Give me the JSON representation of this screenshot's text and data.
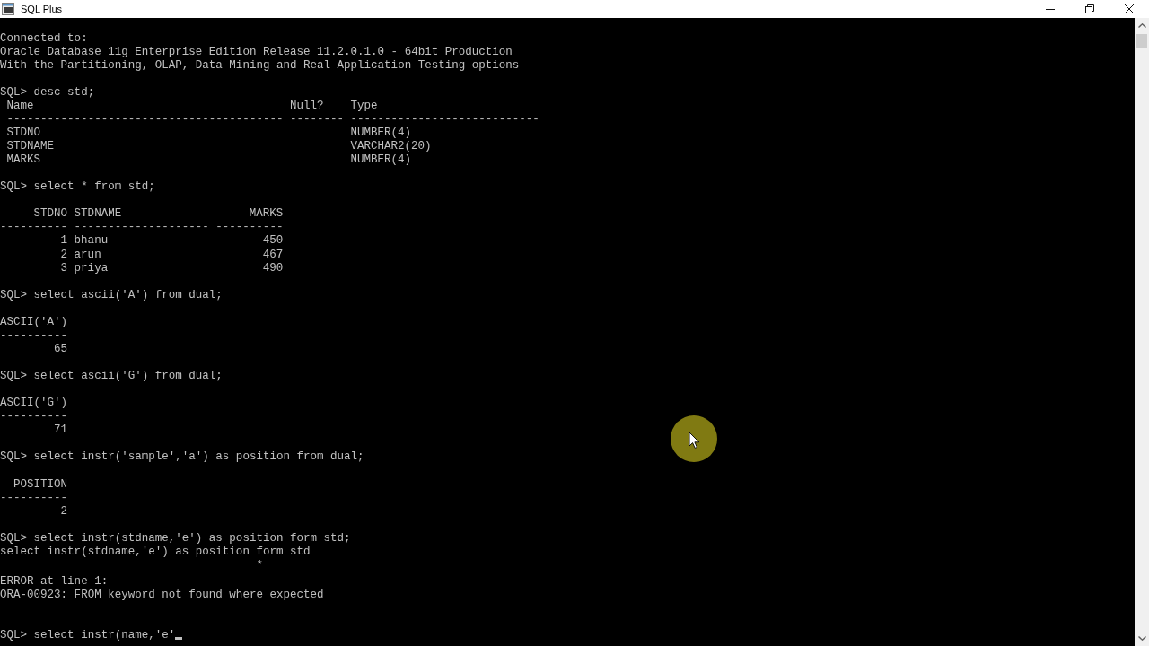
{
  "window": {
    "title": "SQL Plus"
  },
  "console": {
    "blocks": [
      {
        "kind": "text",
        "lines": [
          "Connected to:",
          "Oracle Database 11g Enterprise Edition Release 11.2.0.1.0 - 64bit Production",
          "With the Partitioning, OLAP, Data Mining and Real Application Testing options"
        ]
      },
      {
        "kind": "text",
        "lines": [
          "SQL> desc std;"
        ]
      },
      {
        "kind": "describe",
        "columns": [
          {
            "heading": "Name",
            "rule": "-----------------------------------------",
            "kind": "text"
          },
          {
            "heading": "Null?",
            "rule": "--------",
            "kind": "text"
          },
          {
            "heading": "Type",
            "rule": "----------------------------",
            "kind": "text"
          }
        ],
        "rows": [
          [
            "STDNO",
            null,
            "NUMBER(4)"
          ],
          [
            "STDNAME",
            null,
            "VARCHAR2(20)"
          ],
          [
            "MARKS",
            null,
            "NUMBER(4)"
          ]
        ]
      },
      {
        "kind": "text",
        "lines": [
          "SQL> select * from std;"
        ]
      },
      {
        "kind": "result",
        "columns": [
          {
            "heading": "STDNO",
            "rule": "----------",
            "kind": "number"
          },
          {
            "heading": "STDNAME",
            "rule": "--------------------",
            "kind": "text"
          },
          {
            "heading": "MARKS",
            "rule": "----------",
            "kind": "number"
          }
        ],
        "rows": [
          [
            "1",
            "bhanu",
            "450"
          ],
          [
            "2",
            "arun",
            "467"
          ],
          [
            "3",
            "priya",
            "490"
          ]
        ]
      },
      {
        "kind": "text",
        "lines": [
          "SQL> select ascii('A') from dual;"
        ]
      },
      {
        "kind": "result",
        "columns": [
          {
            "heading": "ASCII('A')",
            "rule": "----------",
            "kind": "number"
          }
        ],
        "rows": [
          [
            "65"
          ]
        ]
      },
      {
        "kind": "text",
        "lines": [
          "SQL> select ascii('G') from dual;"
        ]
      },
      {
        "kind": "result",
        "columns": [
          {
            "heading": "ASCII('G')",
            "rule": "----------",
            "kind": "number"
          }
        ],
        "rows": [
          [
            "71"
          ]
        ]
      },
      {
        "kind": "text",
        "lines": [
          "SQL> select instr('sample','a') as position from dual;"
        ]
      },
      {
        "kind": "result",
        "columns": [
          {
            "heading": "POSITION",
            "rule": "----------",
            "kind": "number"
          }
        ],
        "rows": [
          [
            "2"
          ]
        ]
      },
      {
        "kind": "text",
        "lines": [
          "SQL> select instr(stdname,'e') as position form std;",
          "select instr(stdname,'e') as position form std",
          "                                      *"
        ]
      },
      {
        "kind": "error",
        "lines": [
          "ERROR at line 1:",
          "ORA-00923: FROM keyword not found where expected"
        ]
      }
    ],
    "input": {
      "prompt": "SQL>",
      "value": "select instr(name,'e'"
    }
  }
}
